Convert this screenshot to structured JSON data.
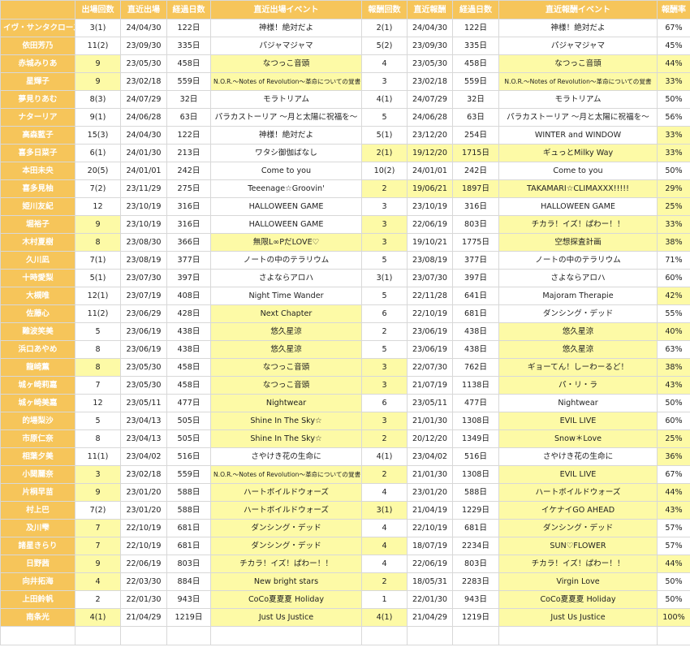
{
  "headers": [
    "",
    "出場回数",
    "直近出場",
    "経過日数",
    "直近出場イベント",
    "報酬回数",
    "直近報酬",
    "経過日数",
    "直近報酬イベント",
    "報酬率"
  ],
  "rows": [
    {
      "name": "イヴ・サンタクロース",
      "appear": "3(1)",
      "last": "24/04/30",
      "days": "122日",
      "event": "神様！絶対だよ",
      "rc": "2(1)",
      "rlast": "24/04/30",
      "rdays": "122日",
      "revent": "神様！絶対だよ",
      "rate": "67%",
      "hl": []
    },
    {
      "name": "依田芳乃",
      "appear": "11(2)",
      "last": "23/09/30",
      "days": "335日",
      "event": "パジャマジャマ",
      "rc": "5(2)",
      "rlast": "23/09/30",
      "rdays": "335日",
      "revent": "パジャマジャマ",
      "rate": "45%",
      "hl": []
    },
    {
      "name": "赤城みりあ",
      "appear": "9",
      "last": "23/05/30",
      "days": "458日",
      "event": "なつっこ音頭",
      "rc": "4",
      "rlast": "23/05/30",
      "rdays": "458日",
      "revent": "なつっこ音頭",
      "rate": "44%",
      "hl": [
        "appear",
        "event",
        "revent",
        "rate"
      ]
    },
    {
      "name": "星輝子",
      "appear": "9",
      "last": "23/02/18",
      "days": "559日",
      "event": "N.O.R.～Notes of Revolution～革命についての覚書",
      "rc": "3",
      "rlast": "23/02/18",
      "rdays": "559日",
      "revent": "N.O.R.～Notes of Revolution～革命についての覚書",
      "rate": "33%",
      "hl": [
        "appear",
        "event",
        "revent",
        "rate"
      ]
    },
    {
      "name": "夢見りあむ",
      "appear": "8(3)",
      "last": "24/07/29",
      "days": "32日",
      "event": "モラトリアム",
      "rc": "4(1)",
      "rlast": "24/07/29",
      "rdays": "32日",
      "revent": "モラトリアム",
      "rate": "50%",
      "hl": []
    },
    {
      "name": "ナターリア",
      "appear": "9(1)",
      "last": "24/06/28",
      "days": "63日",
      "event": "パラカストーリア ～月と太陽に祝福を～",
      "rc": "5",
      "rlast": "24/06/28",
      "rdays": "63日",
      "revent": "パラカストーリア ～月と太陽に祝福を～",
      "rate": "56%",
      "hl": []
    },
    {
      "name": "高森藍子",
      "appear": "15(3)",
      "last": "24/04/30",
      "days": "122日",
      "event": "神様！絶対だよ",
      "rc": "5(1)",
      "rlast": "23/12/20",
      "rdays": "254日",
      "revent": "WINTER and WINDOW",
      "rate": "33%",
      "hl": [
        "rate"
      ]
    },
    {
      "name": "喜多日菜子",
      "appear": "6(1)",
      "last": "24/01/30",
      "days": "213日",
      "event": "ワタシ御伽ばなし",
      "rc": "2(1)",
      "rlast": "19/12/20",
      "rdays": "1715日",
      "revent": "ギュっとMilky Way",
      "rate": "33%",
      "hl": [
        "rc",
        "rlast",
        "rdays",
        "revent",
        "rate"
      ]
    },
    {
      "name": "本田未央",
      "appear": "20(5)",
      "last": "24/01/01",
      "days": "242日",
      "event": "Come to you",
      "rc": "10(2)",
      "rlast": "24/01/01",
      "rdays": "242日",
      "revent": "Come to you",
      "rate": "50%",
      "hl": []
    },
    {
      "name": "喜多見柚",
      "appear": "7(2)",
      "last": "23/11/29",
      "days": "275日",
      "event": "Teeenage☆Groovin'",
      "rc": "2",
      "rlast": "19/06/21",
      "rdays": "1897日",
      "revent": "TAKAMARI☆CLIMAXXX!!!!!",
      "rate": "29%",
      "hl": [
        "rc",
        "rlast",
        "rdays",
        "revent",
        "rate"
      ]
    },
    {
      "name": "姫川友紀",
      "appear": "12",
      "last": "23/10/19",
      "days": "316日",
      "event": "HALLOWEEN GAME",
      "rc": "3",
      "rlast": "23/10/19",
      "rdays": "316日",
      "revent": "HALLOWEEN GAME",
      "rate": "25%",
      "hl": [
        "rate"
      ]
    },
    {
      "name": "堀裕子",
      "appear": "9",
      "last": "23/10/19",
      "days": "316日",
      "event": "HALLOWEEN GAME",
      "rc": "3",
      "rlast": "22/06/19",
      "rdays": "803日",
      "revent": "チカラ！イズ！ぱわー！！",
      "rate": "33%",
      "hl": [
        "appear",
        "rc",
        "revent",
        "rate"
      ]
    },
    {
      "name": "木村夏樹",
      "appear": "8",
      "last": "23/08/30",
      "days": "366日",
      "event": "無限L∞PだLOVE♡",
      "rc": "3",
      "rlast": "19/10/21",
      "rdays": "1775日",
      "revent": "空想探査計画",
      "rate": "38%",
      "hl": [
        "appear",
        "event",
        "rc",
        "revent",
        "rate"
      ]
    },
    {
      "name": "久川凪",
      "appear": "7(1)",
      "last": "23/08/19",
      "days": "377日",
      "event": "ノートの中のテラリウム",
      "rc": "5",
      "rlast": "23/08/19",
      "rdays": "377日",
      "revent": "ノートの中のテラリウム",
      "rate": "71%",
      "hl": []
    },
    {
      "name": "十時愛梨",
      "appear": "5(1)",
      "last": "23/07/30",
      "days": "397日",
      "event": "さよならアロハ",
      "rc": "3(1)",
      "rlast": "23/07/30",
      "rdays": "397日",
      "revent": "さよならアロハ",
      "rate": "60%",
      "hl": []
    },
    {
      "name": "大槻唯",
      "appear": "12(1)",
      "last": "23/07/19",
      "days": "408日",
      "event": "Night Time Wander",
      "rc": "5",
      "rlast": "22/11/28",
      "rdays": "641日",
      "revent": "Majoram Therapie",
      "rate": "42%",
      "hl": [
        "rate"
      ]
    },
    {
      "name": "佐藤心",
      "appear": "11(2)",
      "last": "23/06/29",
      "days": "428日",
      "event": "Next Chapter",
      "rc": "6",
      "rlast": "22/10/19",
      "rdays": "681日",
      "revent": "ダンシング・デッド",
      "rate": "55%",
      "hl": [
        "event"
      ]
    },
    {
      "name": "難波笑美",
      "appear": "5",
      "last": "23/06/19",
      "days": "438日",
      "event": "悠久星涼",
      "rc": "2",
      "rlast": "23/06/19",
      "rdays": "438日",
      "revent": "悠久星涼",
      "rate": "40%",
      "hl": [
        "event",
        "revent",
        "rate"
      ]
    },
    {
      "name": "浜口あやめ",
      "appear": "8",
      "last": "23/06/19",
      "days": "438日",
      "event": "悠久星涼",
      "rc": "5",
      "rlast": "23/06/19",
      "rdays": "438日",
      "revent": "悠久星涼",
      "rate": "63%",
      "hl": [
        "event",
        "revent"
      ]
    },
    {
      "name": "龍崎薫",
      "appear": "8",
      "last": "23/05/30",
      "days": "458日",
      "event": "なつっこ音頭",
      "rc": "3",
      "rlast": "22/07/30",
      "rdays": "762日",
      "revent": "ギョーてん！しーわーるど！",
      "rate": "38%",
      "hl": [
        "appear",
        "event",
        "rc",
        "revent",
        "rate"
      ]
    },
    {
      "name": "城ヶ崎莉嘉",
      "appear": "7",
      "last": "23/05/30",
      "days": "458日",
      "event": "なつっこ音頭",
      "rc": "3",
      "rlast": "21/07/19",
      "rdays": "1138日",
      "revent": "パ・リ・ラ",
      "rate": "43%",
      "hl": [
        "event",
        "rc",
        "revent",
        "rate"
      ]
    },
    {
      "name": "城ヶ崎美嘉",
      "appear": "12",
      "last": "23/05/11",
      "days": "477日",
      "event": "Nightwear",
      "rc": "6",
      "rlast": "23/05/11",
      "rdays": "477日",
      "revent": "Nightwear",
      "rate": "50%",
      "hl": [
        "event"
      ]
    },
    {
      "name": "的場梨沙",
      "appear": "5",
      "last": "23/04/13",
      "days": "505日",
      "event": "Shine In The Sky☆",
      "rc": "3",
      "rlast": "21/01/30",
      "rdays": "1308日",
      "revent": "EVIL LIVE",
      "rate": "60%",
      "hl": [
        "event",
        "rc",
        "revent"
      ]
    },
    {
      "name": "市原仁奈",
      "appear": "8",
      "last": "23/04/13",
      "days": "505日",
      "event": "Shine In The Sky☆",
      "rc": "2",
      "rlast": "20/12/20",
      "rdays": "1349日",
      "revent": "Snow＊Love",
      "rate": "25%",
      "hl": [
        "event",
        "rc",
        "revent",
        "rate"
      ]
    },
    {
      "name": "相葉夕美",
      "appear": "11(1)",
      "last": "23/04/02",
      "days": "516日",
      "event": "さやけき花の生命に",
      "rc": "4(1)",
      "rlast": "23/04/02",
      "rdays": "516日",
      "revent": "さやけき花の生命に",
      "rate": "36%",
      "hl": [
        "rate"
      ]
    },
    {
      "name": "小関麗奈",
      "appear": "3",
      "last": "23/02/18",
      "days": "559日",
      "event": "N.O.R.～Notes of Revolution～革命についての覚書",
      "rc": "2",
      "rlast": "21/01/30",
      "rdays": "1308日",
      "revent": "EVIL LIVE",
      "rate": "67%",
      "hl": [
        "appear",
        "event",
        "rc",
        "revent"
      ]
    },
    {
      "name": "片桐早苗",
      "appear": "9",
      "last": "23/01/20",
      "days": "588日",
      "event": "ハートボイルドウォーズ",
      "rc": "4",
      "rlast": "23/01/20",
      "rdays": "588日",
      "revent": "ハートボイルドウォーズ",
      "rate": "44%",
      "hl": [
        "appear",
        "event",
        "revent",
        "rate"
      ]
    },
    {
      "name": "村上巴",
      "appear": "7(2)",
      "last": "23/01/20",
      "days": "588日",
      "event": "ハートボイルドウォーズ",
      "rc": "3(1)",
      "rlast": "21/04/19",
      "rdays": "1229日",
      "revent": "イケナイGO AHEAD",
      "rate": "43%",
      "hl": [
        "event",
        "rc",
        "revent",
        "rate"
      ]
    },
    {
      "name": "及川雫",
      "appear": "7",
      "last": "22/10/19",
      "days": "681日",
      "event": "ダンシング・デッド",
      "rc": "4",
      "rlast": "22/10/19",
      "rdays": "681日",
      "revent": "ダンシング・デッド",
      "rate": "57%",
      "hl": [
        "appear",
        "event",
        "revent"
      ]
    },
    {
      "name": "諸星きらり",
      "appear": "7",
      "last": "22/10/19",
      "days": "681日",
      "event": "ダンシング・デッド",
      "rc": "4",
      "rlast": "18/07/19",
      "rdays": "2234日",
      "revent": "SUN♡FLOWER",
      "rate": "57%",
      "hl": [
        "appear",
        "event",
        "rc",
        "revent"
      ]
    },
    {
      "name": "日野茜",
      "appear": "9",
      "last": "22/06/19",
      "days": "803日",
      "event": "チカラ！イズ！ぱわー！！",
      "rc": "4",
      "rlast": "22/06/19",
      "rdays": "803日",
      "revent": "チカラ！イズ！ぱわー！！",
      "rate": "44%",
      "hl": [
        "appear",
        "event",
        "revent",
        "rate"
      ]
    },
    {
      "name": "向井拓海",
      "appear": "4",
      "last": "22/03/30",
      "days": "884日",
      "event": "New bright stars",
      "rc": "2",
      "rlast": "18/05/31",
      "rdays": "2283日",
      "revent": "Virgin Love",
      "rate": "50%",
      "hl": [
        "appear",
        "event",
        "rc",
        "revent"
      ]
    },
    {
      "name": "上田鈴帆",
      "appear": "2",
      "last": "22/01/30",
      "days": "943日",
      "event": "CoCo夏夏夏 Holiday",
      "rc": "1",
      "rlast": "22/01/30",
      "rdays": "943日",
      "revent": "CoCo夏夏夏 Holiday",
      "rate": "50%",
      "hl": [
        "event",
        "revent"
      ]
    },
    {
      "name": "南条光",
      "appear": "4(1)",
      "last": "21/04/29",
      "days": "1219日",
      "event": "Just Us Justice",
      "rc": "4(1)",
      "rlast": "21/04/29",
      "rdays": "1219日",
      "revent": "Just Us Justice",
      "rate": "100%",
      "hl": [
        "appear",
        "event",
        "rc",
        "revent",
        "rate"
      ]
    }
  ]
}
